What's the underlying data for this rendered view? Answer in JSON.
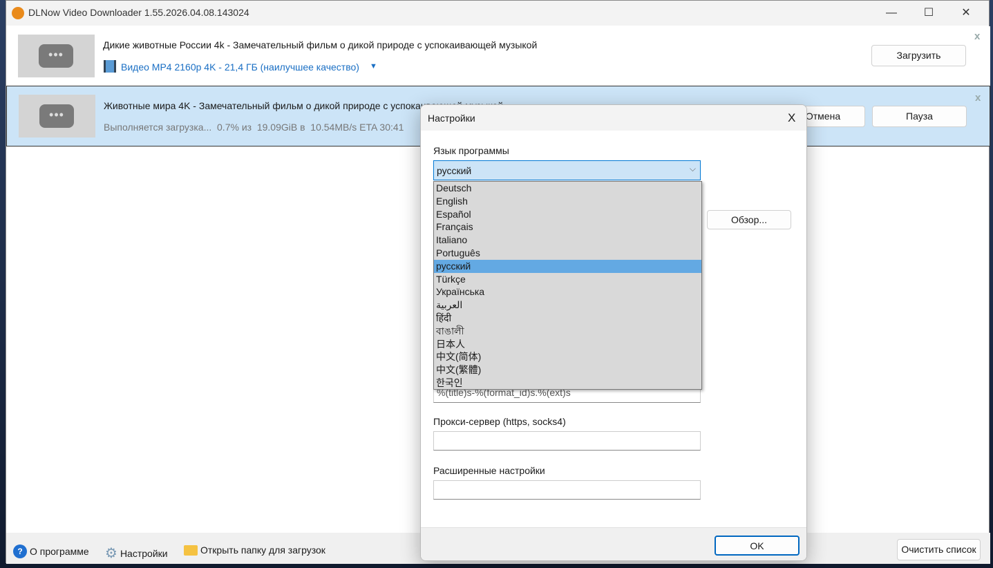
{
  "window": {
    "title": "DLNow Video Downloader 1.55.2026.04.08.143024",
    "minimize": "—",
    "maximize": "☐",
    "close": "✕"
  },
  "items": [
    {
      "title": "Дикие животные России 4k - Замечательный фильм о дикой природе с успокаивающей музыкой",
      "format": "Видео MP4 2160p 4K - 21,4 ГБ (наилучшее качество)",
      "format_caret": "▼",
      "button": "Загрузить",
      "close": "x"
    },
    {
      "title": "Животные мира 4K - Замечательный фильм о дикой природе с успокаивающей музыкой",
      "status": "Выполняется загрузка...  0.7% из  19.09GiB в  10.54MB/s ETA 30:41",
      "progress_percent": 0.7,
      "cancel": "Отмена",
      "pause": "Пауза",
      "close": "x"
    }
  ],
  "bottom": {
    "about": "О программе",
    "settings": "Настройки",
    "open_folder": "Открыть папку для загрузок",
    "clear": "Очистить список"
  },
  "dialog": {
    "title": "Настройки",
    "close": "X",
    "language_label": "Язык программы",
    "language_value": "русский",
    "languages": [
      "Deutsch",
      "English",
      "Español",
      "Français",
      "Italiano",
      "Português",
      "русский",
      "Türkçe",
      "Українська",
      "العربية",
      "हिंदी",
      "বাঙালী",
      "日本人",
      "中文(简体)",
      "中文(繁體)",
      "한국인"
    ],
    "selected_index": 6,
    "browse": "Обзор...",
    "filename_template": "%(title)s-%(format_id)s.%(ext)s",
    "proxy_label": "Прокси-сервер (https, socks4)",
    "proxy_value": "",
    "advanced_label": "Расширенные настройки",
    "advanced_value": "",
    "ok": "OK"
  }
}
